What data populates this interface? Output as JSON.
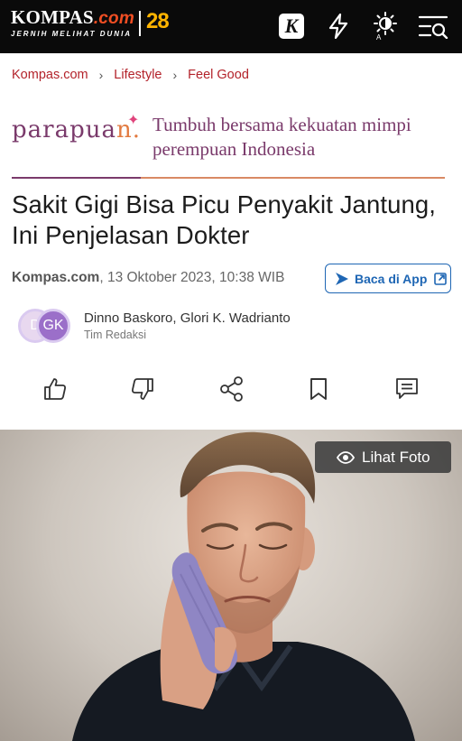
{
  "header": {
    "logo_main": "KOMPAS",
    "logo_com": ".com",
    "logo_tagline": "JERNIH MELIHAT DUNIA",
    "anniversary": "28",
    "k_icon_letter": "K",
    "theme_icon_label": "A"
  },
  "breadcrumb": {
    "items": [
      "Kompas.com",
      "Lifestyle",
      "Feel Good"
    ],
    "separator": "›"
  },
  "partner": {
    "logo_head": "parapua",
    "logo_tail": "n.",
    "tagline_line1": "Tumbuh bersama kekuatan mimpi",
    "tagline_line2": "perempuan Indonesia"
  },
  "article": {
    "title_line1": "Sakit Gigi Bisa Picu Penyakit Jantung,",
    "title_line2": "Ini Penjelasan Dokter",
    "source": "Kompas.com",
    "datetime": ", 13 Oktober 2023, 10:38 WIB",
    "app_button_label": "Baca di App",
    "authors": "Dinno Baskoro, Glori K. Wadrianto",
    "author_role": "Tim Redaksi",
    "avatar1": "D",
    "avatar2": "GK",
    "photo_button_label": "Lihat Foto"
  },
  "colors": {
    "brand_red": "#b3222a",
    "kompas_orange": "#f04e23",
    "parapuan_purple": "#7a3a6b",
    "link_blue": "#1e66b4"
  },
  "icons": [
    "lightning-icon",
    "brightness-icon",
    "menu-search-icon",
    "like-icon",
    "dislike-icon",
    "share-icon",
    "bookmark-icon",
    "comment-icon",
    "eye-icon",
    "external-link-icon",
    "app-logo-icon"
  ]
}
